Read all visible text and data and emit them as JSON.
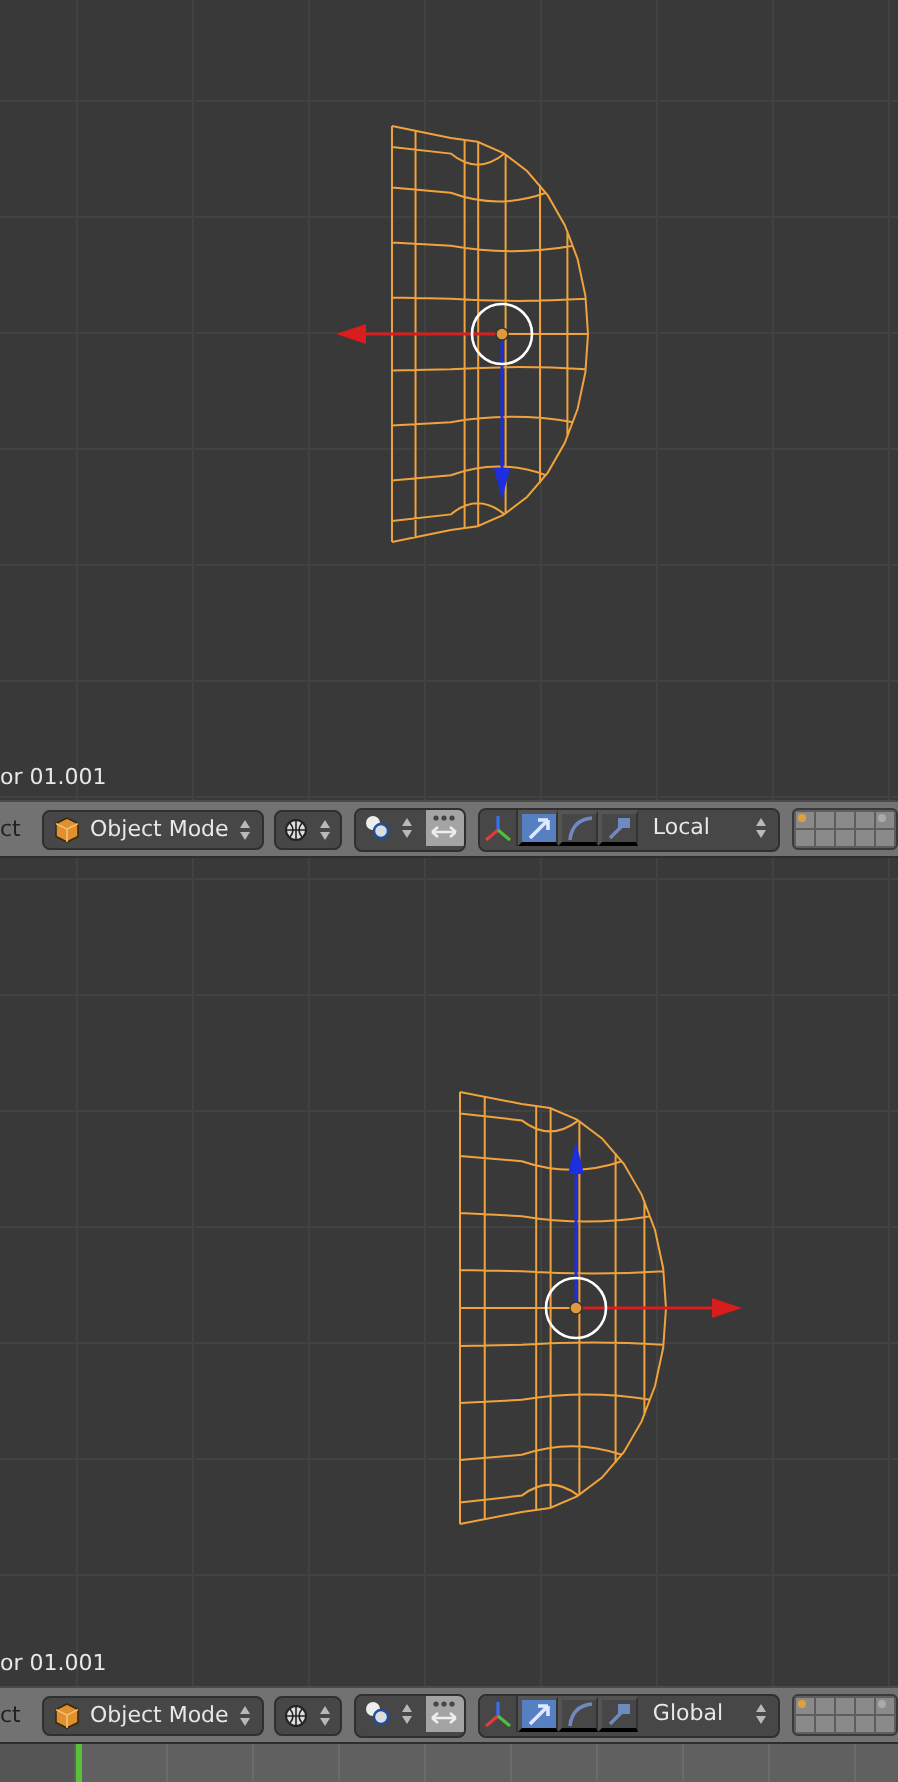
{
  "viewports": [
    {
      "kind": "flipped",
      "object_label": "or 01.001",
      "header": {
        "cut_text": "ct",
        "mode": "Object Mode",
        "orientation": "Local",
        "pivot_toggle": {
          "selected": true
        },
        "manipulators": [
          {
            "kind": "translate",
            "selected": true
          },
          {
            "kind": "rotate",
            "selected": false
          },
          {
            "kind": "scale",
            "selected": false
          }
        ]
      }
    },
    {
      "kind": "upright",
      "object_label": "or 01.001",
      "header": {
        "cut_text": "ct",
        "mode": "Object Mode",
        "orientation": "Global",
        "pivot_toggle": {
          "selected": true
        },
        "manipulators": [
          {
            "kind": "translate",
            "selected": true
          },
          {
            "kind": "rotate",
            "selected": false
          },
          {
            "kind": "scale",
            "selected": false
          }
        ]
      }
    }
  ]
}
